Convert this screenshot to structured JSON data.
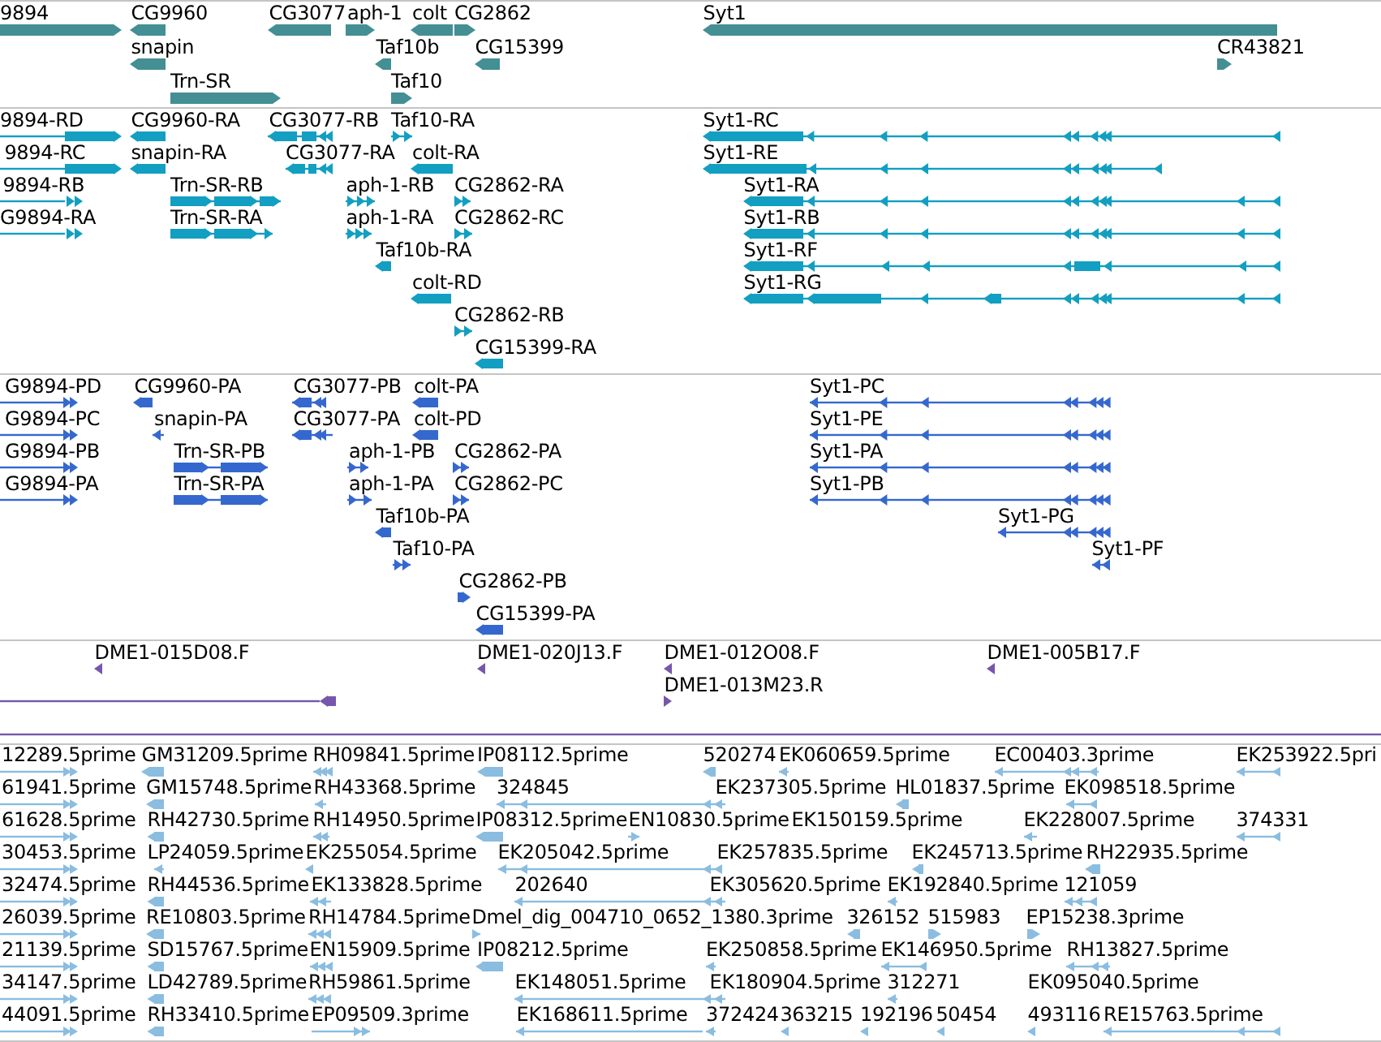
{
  "tracks": [
    {
      "color": "#438f94",
      "features": [
        {
          "label": "9894",
          "reverse": false
        },
        {
          "label": "CG9960",
          "reverse": true
        },
        {
          "label": "CG3077",
          "reverse": true
        },
        {
          "label": "aph-1",
          "reverse": false
        },
        {
          "label": "colt",
          "reverse": true
        },
        {
          "label": "CG2862",
          "reverse": false
        },
        {
          "label": "Syt1",
          "reverse": true
        },
        {
          "label": "snapin",
          "reverse": true
        },
        {
          "label": "Taf10b",
          "reverse": true
        },
        {
          "label": "CG15399",
          "reverse": true
        },
        {
          "label": "CR43821",
          "reverse": false
        },
        {
          "label": "Trn-SR",
          "reverse": false
        },
        {
          "label": "Taf10",
          "reverse": false
        }
      ]
    },
    {
      "color": "#129fc1",
      "features": [
        {
          "label": "9894-RD",
          "reverse": false
        },
        {
          "label": "CG9960-RA",
          "reverse": true
        },
        {
          "label": "CG3077-RB",
          "reverse": true
        },
        {
          "label": "Taf10-RA",
          "reverse": false
        },
        {
          "label": "Syt1-RC",
          "reverse": true
        },
        {
          "label": "9894-RC",
          "reverse": false
        },
        {
          "label": "snapin-RA",
          "reverse": true
        },
        {
          "label": "CG3077-RA",
          "reverse": true
        },
        {
          "label": "colt-RA",
          "reverse": true
        },
        {
          "label": "Syt1-RE",
          "reverse": true
        },
        {
          "label": "9894-RB",
          "reverse": false
        },
        {
          "label": "Trn-SR-RB",
          "reverse": false
        },
        {
          "label": "aph-1-RB",
          "reverse": false
        },
        {
          "label": "CG2862-RA",
          "reverse": false
        },
        {
          "label": "Syt1-RA",
          "reverse": true
        },
        {
          "label": "G9894-RA",
          "reverse": false
        },
        {
          "label": "Trn-SR-RA",
          "reverse": false
        },
        {
          "label": "aph-1-RA",
          "reverse": false
        },
        {
          "label": "CG2862-RC",
          "reverse": false
        },
        {
          "label": "Syt1-RB",
          "reverse": true
        },
        {
          "label": "Taf10b-RA",
          "reverse": true
        },
        {
          "label": "Syt1-RF",
          "reverse": true
        },
        {
          "label": "colt-RD",
          "reverse": true
        },
        {
          "label": "Syt1-RG",
          "reverse": true
        },
        {
          "label": "CG2862-RB",
          "reverse": false
        },
        {
          "label": "CG15399-RA",
          "reverse": true
        }
      ]
    },
    {
      "color": "#3568cf",
      "features": [
        {
          "label": "G9894-PD",
          "reverse": false
        },
        {
          "label": "CG9960-PA",
          "reverse": true
        },
        {
          "label": "CG3077-PB",
          "reverse": true
        },
        {
          "label": "colt-PA",
          "reverse": true
        },
        {
          "label": "Syt1-PC",
          "reverse": true
        },
        {
          "label": "G9894-PC",
          "reverse": false
        },
        {
          "label": "snapin-PA",
          "reverse": true
        },
        {
          "label": "CG3077-PA",
          "reverse": true
        },
        {
          "label": "colt-PD",
          "reverse": true
        },
        {
          "label": "Syt1-PE",
          "reverse": true
        },
        {
          "label": "G9894-PB",
          "reverse": false
        },
        {
          "label": "Trn-SR-PB",
          "reverse": false
        },
        {
          "label": "aph-1-PB",
          "reverse": false
        },
        {
          "label": "CG2862-PA",
          "reverse": false
        },
        {
          "label": "Syt1-PA",
          "reverse": true
        },
        {
          "label": "G9894-PA",
          "reverse": false
        },
        {
          "label": "Trn-SR-PA",
          "reverse": false
        },
        {
          "label": "aph-1-PA",
          "reverse": false
        },
        {
          "label": "CG2862-PC",
          "reverse": false
        },
        {
          "label": "Syt1-PB",
          "reverse": true
        },
        {
          "label": "Taf10b-PA",
          "reverse": true
        },
        {
          "label": "Syt1-PG",
          "reverse": true
        },
        {
          "label": "Taf10-PA",
          "reverse": false
        },
        {
          "label": "Syt1-PF",
          "reverse": true
        },
        {
          "label": "CG2862-PB",
          "reverse": false
        },
        {
          "label": "CG15399-PA",
          "reverse": true
        }
      ]
    },
    {
      "color": "#7657ac",
      "features": [
        {
          "label": "DME1-015D08.F",
          "reverse": true
        },
        {
          "label": "DME1-020J13.F",
          "reverse": true
        },
        {
          "label": "DME1-012O08.F",
          "reverse": true
        },
        {
          "label": "DME1-005B17.F",
          "reverse": true
        },
        {
          "reverse": true
        },
        {
          "label": "DME1-013M23.R",
          "reverse": false
        }
      ]
    },
    {
      "color": "#8abde0",
      "features": [
        {
          "label": "12289.5prime",
          "reverse": false
        },
        {
          "label": "GM31209.5prime",
          "reverse": true
        },
        {
          "label": "RH09841.5prime",
          "reverse": true
        },
        {
          "label": "IP08112.5prime",
          "reverse": true
        },
        {
          "label": "520274",
          "reverse": true
        },
        {
          "label": "EK060659.5prime",
          "reverse": true
        },
        {
          "label": "EC00403.3prime",
          "reverse": true
        },
        {
          "label": "EK253922.5pri",
          "reverse": true
        },
        {
          "label": "61941.5prime",
          "reverse": false
        },
        {
          "label": "GM15748.5prime",
          "reverse": true
        },
        {
          "label": "RH43368.5prime",
          "reverse": true
        },
        {
          "label": "324845",
          "reverse": true
        },
        {
          "label": "EK237305.5prime"
        },
        {
          "label": "HL01837.5prime",
          "reverse": true
        },
        {
          "label": "EK098518.5prime",
          "reverse": true
        },
        {
          "label": "61628.5prime",
          "reverse": false
        },
        {
          "label": "RH42730.5prime",
          "reverse": true
        },
        {
          "label": "RH14950.5prime",
          "reverse": true
        },
        {
          "label": "IP08312.5prime",
          "reverse": true
        },
        {
          "label": "EN10830.5prime",
          "reverse": false
        },
        {
          "label": "EK150159.5prime"
        },
        {
          "label": "EK228007.5prime",
          "reverse": true
        },
        {
          "label": "374331",
          "reverse": true
        },
        {
          "label": "30453.5prime",
          "reverse": false
        },
        {
          "label": "LP24059.5prime",
          "reverse": true
        },
        {
          "label": "EK255054.5prime",
          "reverse": true
        },
        {
          "label": "EK205042.5prime",
          "reverse": true
        },
        {
          "label": "EK257835.5prime"
        },
        {
          "label": "EK245713.5prime",
          "reverse": true
        },
        {
          "label": "RH22935.5prime",
          "reverse": true
        },
        {
          "label": "32474.5prime",
          "reverse": false
        },
        {
          "label": "RH44536.5prime",
          "reverse": true
        },
        {
          "label": "EK133828.5prime",
          "reverse": true
        },
        {
          "label": "202640",
          "reverse": true
        },
        {
          "label": "EK305620.5prime"
        },
        {
          "label": "EK192840.5prime",
          "reverse": true
        },
        {
          "label": "121059",
          "reverse": true
        },
        {
          "label": "26039.5prime",
          "reverse": false
        },
        {
          "label": "RE10803.5prime",
          "reverse": true
        },
        {
          "label": "RH14784.5prime",
          "reverse": true
        },
        {
          "label": "Dmel_dig_004710_0652_1380.3prime",
          "reverse": false
        },
        {
          "label": "326152",
          "reverse": true
        },
        {
          "label": "515983",
          "reverse": false
        },
        {
          "label": "EP15238.3prime",
          "reverse": false
        },
        {
          "label": "21139.5prime",
          "reverse": false
        },
        {
          "label": "SD15767.5prime",
          "reverse": true
        },
        {
          "label": "EN15909.5prime",
          "reverse": true
        },
        {
          "label": "IP08212.5prime",
          "reverse": true
        },
        {
          "label": "EK250858.5prime",
          "reverse": true
        },
        {
          "label": "EK146950.5prime",
          "reverse": true
        },
        {
          "label": "RH13827.5prime",
          "reverse": true
        },
        {
          "label": "34147.5prime",
          "reverse": false
        },
        {
          "label": "LD42789.5prime",
          "reverse": true
        },
        {
          "label": "RH59861.5prime",
          "reverse": true
        },
        {
          "label": "EK148051.5prime",
          "reverse": true
        },
        {
          "label": "EK180904.5prime"
        },
        {
          "label": "312271",
          "reverse": true
        },
        {
          "label": "EK095040.5prime"
        },
        {
          "label": "44091.5prime",
          "reverse": false
        },
        {
          "label": "RH33410.5prime",
          "reverse": true
        },
        {
          "label": "EP09509.3prime",
          "reverse": false
        },
        {
          "label": "EK168611.5prime",
          "reverse": true
        },
        {
          "label": "372424",
          "reverse": true
        },
        {
          "label": "363215",
          "reverse": true
        },
        {
          "label": "192196",
          "reverse": true
        },
        {
          "label": "50454",
          "reverse": true
        },
        {
          "label": "493116",
          "reverse": true
        },
        {
          "label": "RE15763.5prime",
          "reverse": true
        }
      ]
    }
  ]
}
